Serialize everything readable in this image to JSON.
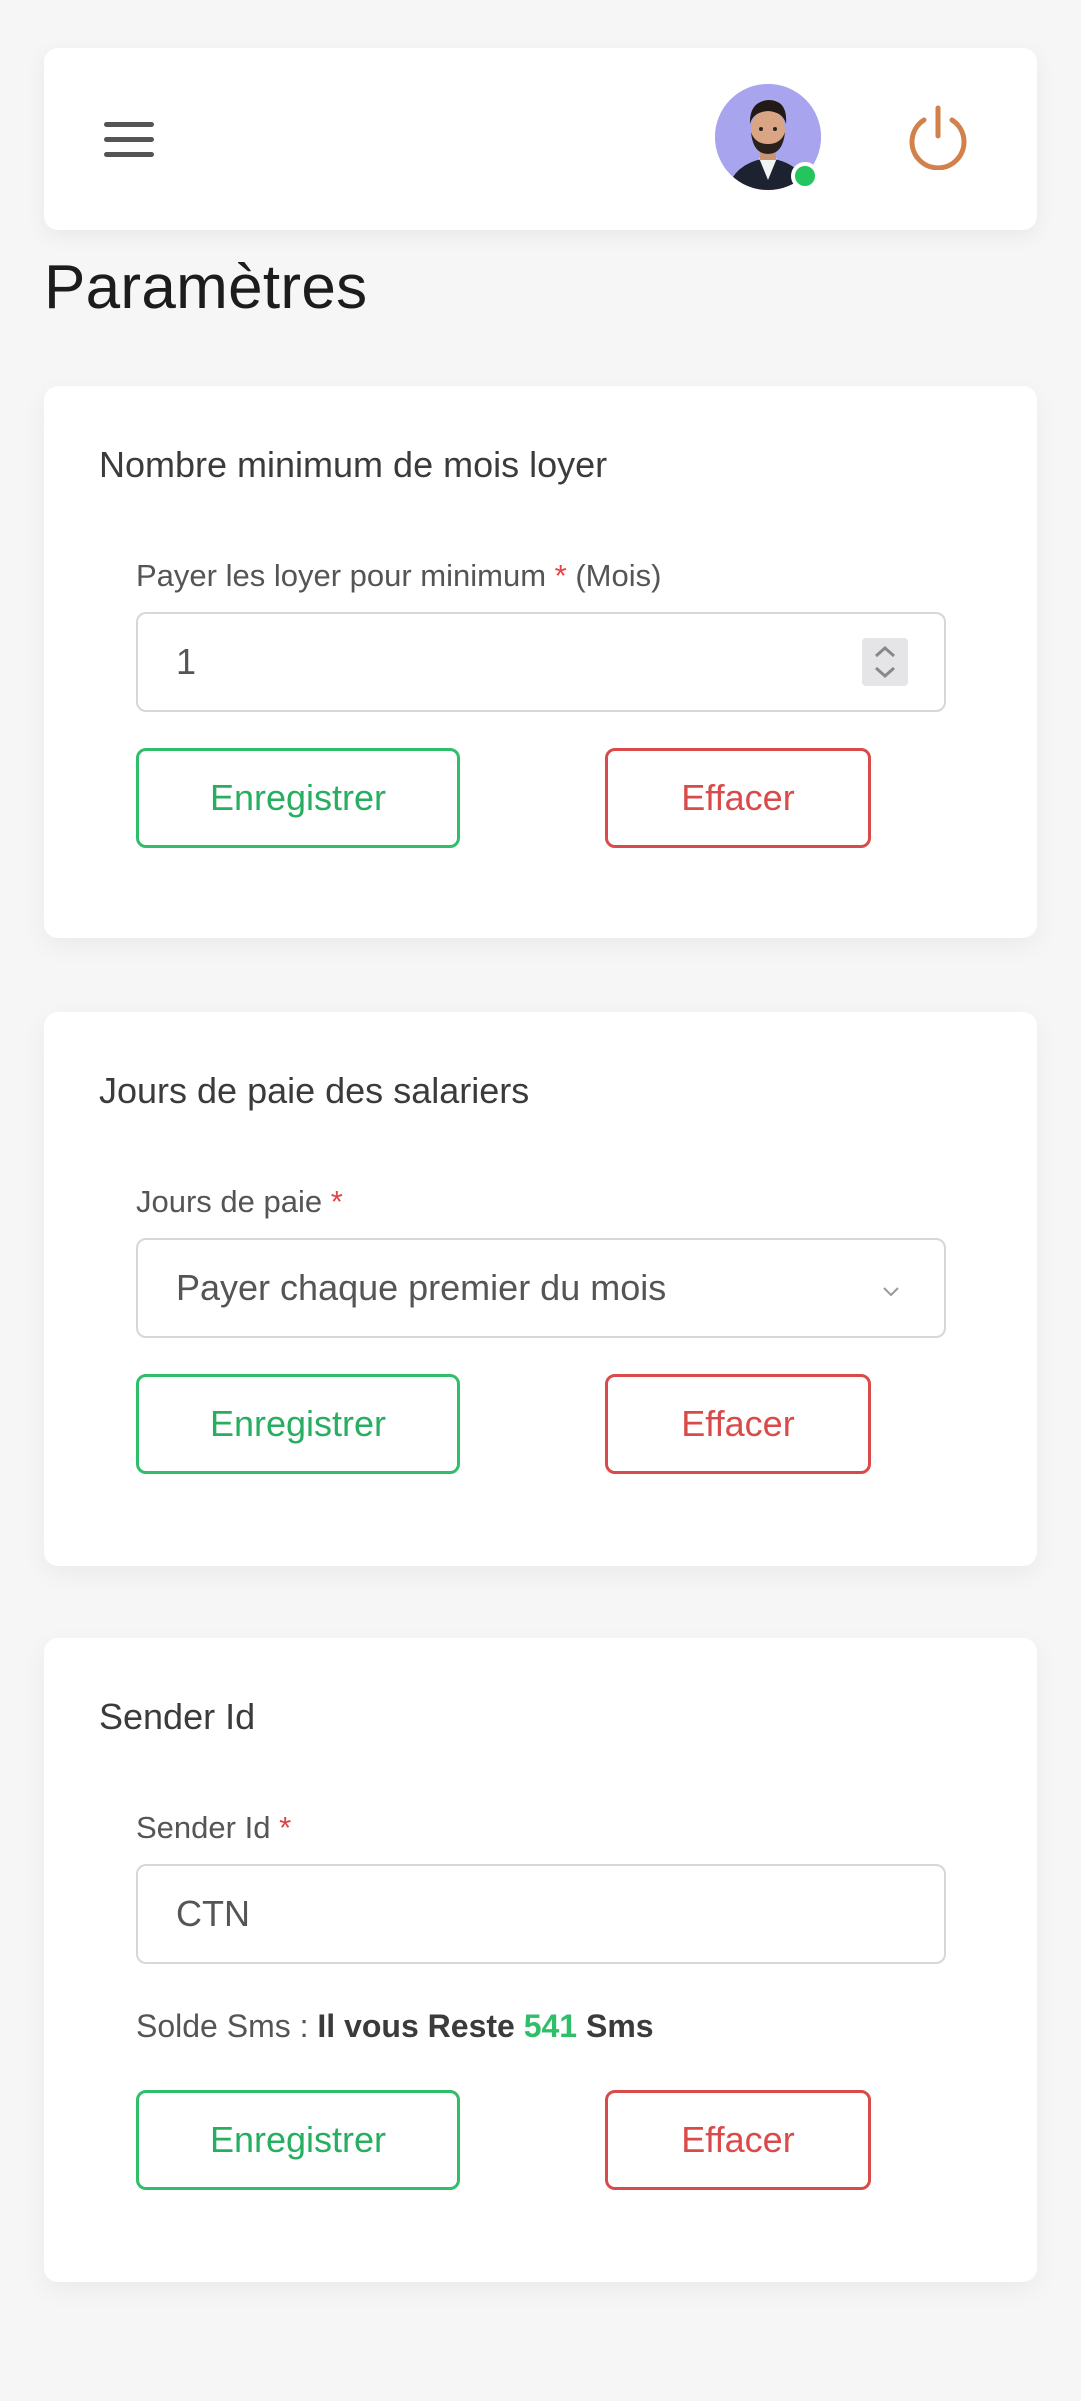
{
  "header": {
    "menu_icon": "hamburger-menu-icon",
    "avatar_icon": "user-avatar",
    "status": "online",
    "power_icon": "power-icon",
    "power_color": "#d2814a",
    "online_color": "#22c55e"
  },
  "page": {
    "title": "Paramètres"
  },
  "colors": {
    "accent_green": "#2fbf6b",
    "accent_red": "#d94a4a",
    "background": "#f6f6f7"
  },
  "cards": [
    {
      "title": "Nombre minimum de mois loyer",
      "label": "Payer les loyer pour minimum",
      "required_mark": "*",
      "label_suffix": "(Mois)",
      "input_value": "1",
      "save_label": "Enregistrer",
      "clear_label": "Effacer"
    },
    {
      "title": "Jours de paie des salariers",
      "label": "Jours de paie",
      "required_mark": "*",
      "selected_value": "Payer chaque premier du mois",
      "save_label": "Enregistrer",
      "clear_label": "Effacer"
    },
    {
      "title": "Sender Id",
      "label": "Sender Id",
      "required_mark": "*",
      "input_value": "CTN",
      "sms_prefix": "Solde Sms :",
      "sms_text_before": "Il vous Reste",
      "sms_count": "541",
      "sms_text_after": "Sms",
      "save_label": "Enregistrer",
      "clear_label": "Effacer"
    }
  ]
}
